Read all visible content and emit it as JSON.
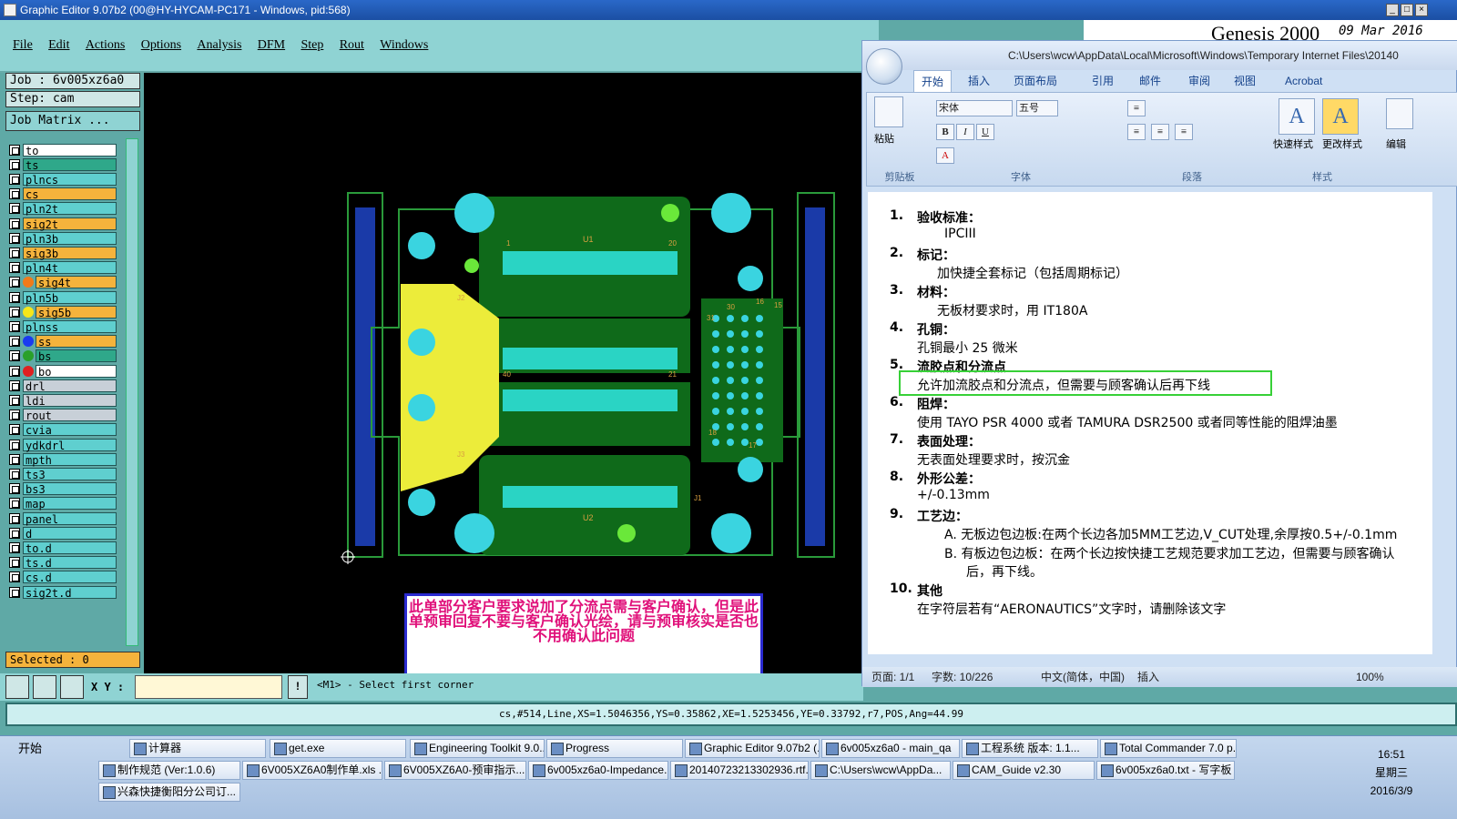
{
  "window": {
    "title": "Graphic Editor 9.07b2 (00@HY-HYCAM-PC171 - Windows, pid:568)"
  },
  "menu": [
    "File",
    "Edit",
    "Actions",
    "Options",
    "Analysis",
    "DFM",
    "Step",
    "Rout",
    "Windows"
  ],
  "genesis": {
    "brand": "Genesis 2000",
    "date": "09 Mar 2016"
  },
  "job": {
    "job": "Job : 6v005xz6a0",
    "step": "Step: cam",
    "matrix": "Job Matrix ..."
  },
  "layers": [
    "to",
    "ts",
    "plncs",
    "cs",
    "pln2t",
    "sig2t",
    "pln3b",
    "sig3b",
    "pln4t",
    "sig4t",
    "pln5b",
    "sig5b",
    "plnss",
    "ss",
    "bs",
    "bo",
    "drl",
    "ldi",
    "rout",
    "cvia",
    "ydkdrl",
    "mpth",
    "ts3",
    "bs3",
    "map",
    "panel",
    "d",
    "to.d",
    "ts.d",
    "cs.d",
    "sig2t.d"
  ],
  "layer_colors": {
    "to": "#ffffff",
    "ts": "#2fa88a",
    "cs": "#f5b33c",
    "sig2t": "#f5b33c",
    "sig3b": "#f5b33c",
    "sig4t": "#f5b33c",
    "sig5b": "#f5b33c",
    "ss": "#f5b33c",
    "bs": "#2fa88a",
    "bo": "#ffffff",
    "drl": "#c8d0d8",
    "ldi": "#c8d0d8",
    "rout": "#c8d0d8"
  },
  "selected": "Selected : 0",
  "bottom": {
    "xy_label": "X Y :",
    "prompt": "<M1> - Select first corner",
    "status": "cs,#514,Line,XS=1.5046356,YS=0.35862,XE=1.5253456,YE=0.33792,r7,POS,Ang=44.99"
  },
  "note": {
    "text": "此单部分客户要求说加了分流点需与客户确认，但是此单预审回复不要与客户确认光绘，请与预审核实是否也不用确认此问题"
  },
  "pcb_labels": {
    "u1": "U1",
    "u2": "U2",
    "n1": "1",
    "n20": "20",
    "n21": "21",
    "n40": "40",
    "j1": "J1",
    "j2": "J2",
    "j3": "J3",
    "n30": "30",
    "n16": "16",
    "n15": "15",
    "n31": "31",
    "n17": "17",
    "n18": "18"
  },
  "word": {
    "title": "C:\\Users\\wcw\\AppData\\Local\\Microsoft\\Windows\\Temporary Internet Files\\20140",
    "tabs": [
      "开始",
      "插入",
      "页面布局",
      "引用",
      "邮件",
      "审阅",
      "视图",
      "Acrobat"
    ],
    "groups": {
      "clipboard": "剪贴板",
      "font": "字体",
      "paragraph": "段落",
      "styles": "样式"
    },
    "ribbon": {
      "paste": "粘贴",
      "font_name": "宋体",
      "font_size": "五号",
      "quick_style": "快速样式",
      "change_style": "更改样式",
      "edit": "编辑"
    },
    "doc": [
      {
        "n": "1.",
        "h": "验收标准：",
        "b": "IPCIII"
      },
      {
        "n": "2.",
        "h": "标记：",
        "b": "加快捷全套标记（包括周期标记）"
      },
      {
        "n": "3.",
        "h": "材料：",
        "b": "无板材要求时，用 IT180A"
      },
      {
        "n": "4.",
        "h": "孔铜：",
        "b": "孔铜最小 25 微米"
      },
      {
        "n": "5.",
        "h": "流胶点和分流点",
        "b": "允许加流胶点和分流点，但需要与顾客确认后再下线"
      },
      {
        "n": "6.",
        "h": "阻焊：",
        "b": "使用 TAYO PSR 4000    或者    TAMURA    DSR2500 或者同等性能的阻焊油墨"
      },
      {
        "n": "7.",
        "h": "表面处理：",
        "b": "无表面处理要求时，按沉金"
      },
      {
        "n": "8.",
        "h": "外形公差：",
        "b": "+/-0.13mm"
      },
      {
        "n": "9.",
        "h": "工艺边：",
        "a": "A. 无板边包边板:在两个长边各加5MM工艺边,V_CUT处理,余厚按0.5+/-0.1mm",
        "bb": "B. 有板边包边板：在两个长边按快捷工艺规范要求加工艺边，但需要与顾客确认",
        "bc": "后，再下线。"
      },
      {
        "n": "10.",
        "h": "其他",
        "b": "在字符层若有“AERONAUTICS”文字时，请删除该文字"
      }
    ],
    "status": {
      "page": "页面: 1/1",
      "words": "字数: 10/226",
      "lang": "中文(简体，中国)",
      "mode": "插入",
      "zoom": "100%"
    }
  },
  "taskbar": {
    "start": "开始",
    "row1": [
      "计算器",
      "get.exe",
      "Engineering Toolkit 9.0...",
      "Progress",
      "Graphic Editor 9.07b2 (...",
      "6v005xz6a0 - main_qa",
      "工程系统 版本: 1.1...",
      "Total Commander 7.0 p..."
    ],
    "row2": [
      "制作规范 (Ver:1.0.6)",
      "6V005XZ6A0制作单.xls ...",
      "6V005XZ6A0-预审指示...",
      "6v005xz6a0-Impedance...",
      "20140723213302936.rtf...",
      "C:\\Users\\wcw\\AppDa...",
      "CAM_Guide v2.30",
      "6v005xz6a0.txt - 写字板"
    ],
    "row3": [
      "兴森快捷衡阳分公司订..."
    ],
    "clock": {
      "time": "16:51",
      "day": "星期三",
      "date": "2016/3/9"
    }
  }
}
